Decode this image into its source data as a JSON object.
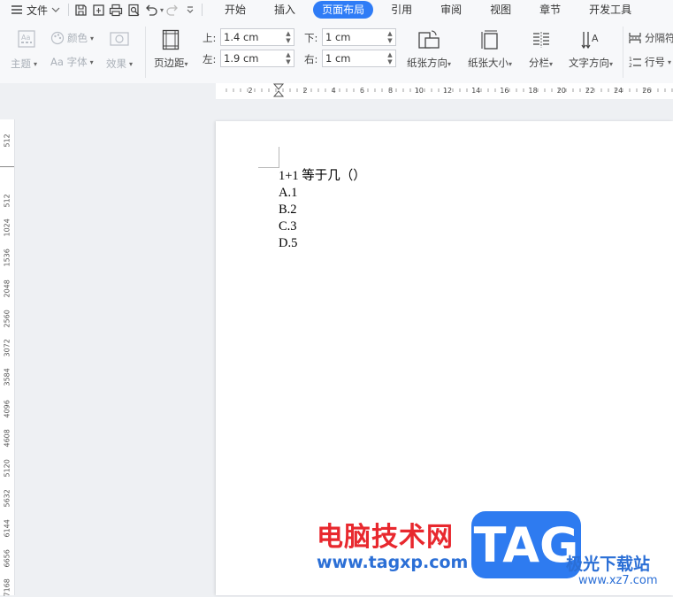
{
  "menu": {
    "file_label": "文件"
  },
  "tabs": [
    {
      "label": "开始"
    },
    {
      "label": "插入"
    },
    {
      "label": "页面布局"
    },
    {
      "label": "引用"
    },
    {
      "label": "审阅"
    },
    {
      "label": "视图"
    },
    {
      "label": "章节"
    },
    {
      "label": "开发工具"
    }
  ],
  "ribbon": {
    "theme_label": "主题",
    "color_label": "颜色",
    "font_label": "Aa 字体",
    "effect_label": "效果",
    "margins_label": "页边距",
    "top_label": "上:",
    "top_value": "1.4 cm",
    "bottom_label": "下:",
    "bottom_value": "1 cm",
    "left_label": "左:",
    "left_value": "1.9 cm",
    "right_label": "右:",
    "right_value": "1 cm",
    "orientation_label": "纸张方向",
    "size_label": "纸张大小",
    "columns_label": "分栏",
    "text_dir_label": "文字方向",
    "breaks_label": "分隔符",
    "line_num_label": "行号"
  },
  "hruler_ticks": [
    "2",
    "2",
    "4",
    "6",
    "8",
    "10",
    "12",
    "14",
    "16",
    "18",
    "20",
    "22",
    "24",
    "26"
  ],
  "vruler_ticks": [
    "512",
    "512",
    "1024",
    "1536",
    "2048",
    "2560",
    "3072",
    "3584",
    "4096",
    "4608",
    "5120",
    "5632",
    "6144",
    "6656",
    "7168"
  ],
  "document": {
    "question": "1+1 等于几（）",
    "options": [
      "A.1",
      "B.2",
      "C.3",
      "D.5"
    ]
  },
  "watermark": {
    "cn_text": "电脑技术网",
    "url": "www.tagxp.com",
    "tag": "TAG",
    "site_name": "极光下载站",
    "site_url": "www.xz7.com"
  },
  "colors": {
    "accent": "#2f7cf6",
    "watermark_red": "#e8282e",
    "watermark_blue": "#2b6fd6"
  }
}
